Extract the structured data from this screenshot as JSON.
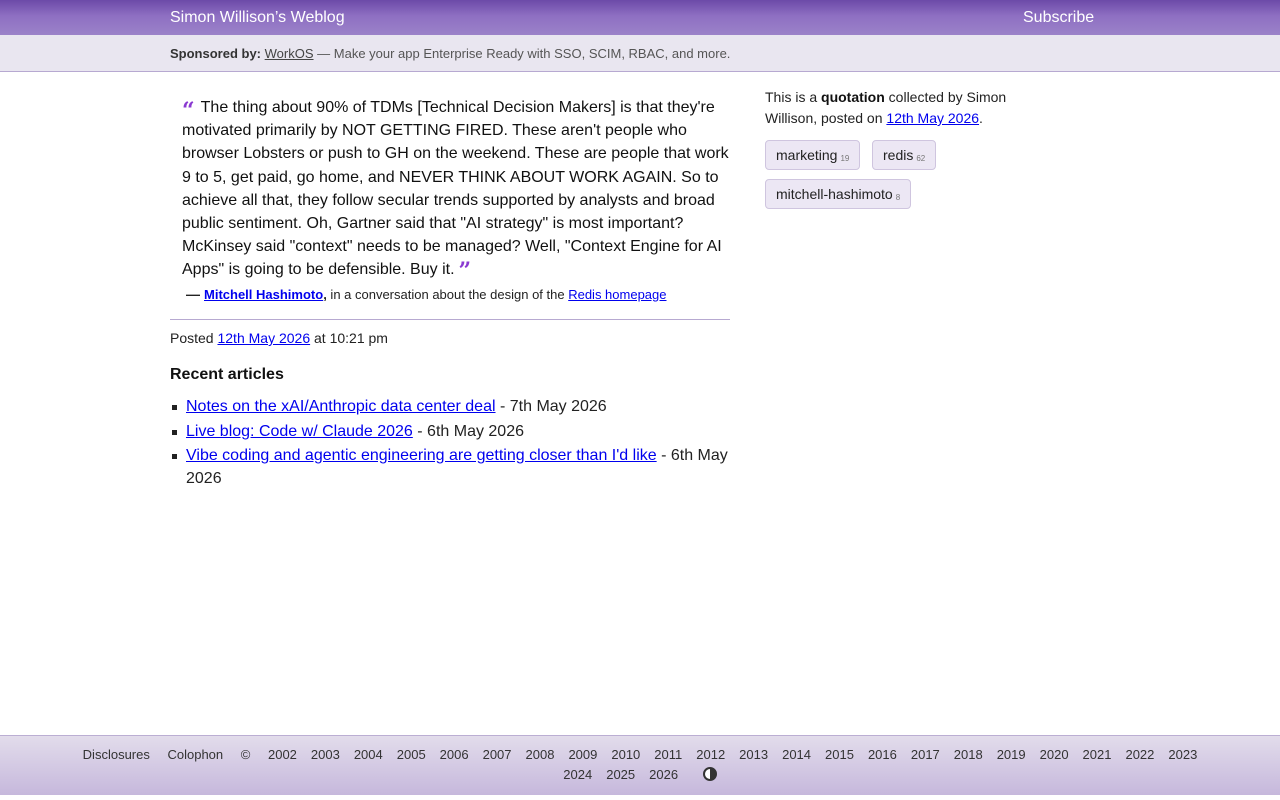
{
  "header": {
    "site_title": "Simon Willison’s Weblog",
    "subscribe": "Subscribe"
  },
  "sponsor": {
    "label": "Sponsored by:",
    "name": "WorkOS",
    "text": " — Make your app Enterprise Ready with SSO, SCIM, RBAC, and more."
  },
  "quote": {
    "open_mark": "“",
    "text": "The thing about 90% of TDMs [Technical Decision Makers] is that they're motivated primarily by NOT GETTING FIRED. These aren't people who browser Lobsters or push to GH on the weekend. These are people that work 9 to 5, get paid, go home, and NEVER THINK ABOUT WORK AGAIN. So to achieve all that, they follow secular trends supported by analysts and broad public sentiment. Oh, Gartner said that \"AI strategy\" is most important? McKinsey said \"context\" needs to be managed? Well, \"Context Engine for AI Apps\" is going to be defensible. Buy it.",
    "close_mark": "”",
    "cite_dash": "—",
    "author": "Mitchell Hashimoto",
    "author_comma": ",",
    "context": " in a conversation about the design of the ",
    "source_link": "Redis homepage"
  },
  "posted": {
    "prefix": "Posted ",
    "date": "12th May 2026",
    "time": " at 10:21 pm"
  },
  "recent": {
    "title": "Recent articles",
    "items": [
      {
        "title": "Notes on the xAI/Anthropic data center deal",
        "date": " - 7th May 2026"
      },
      {
        "title": "Live blog: Code w/ Claude 2026",
        "date": " - 6th May 2026"
      },
      {
        "title": "Vibe coding and agentic engineering are getting closer than I'd like",
        "date": " - 6th May 2026"
      }
    ]
  },
  "meta": {
    "prefix": "This is a ",
    "type": "quotation",
    "middle": " collected by Simon Willison, posted on ",
    "date": "12th May 2026",
    "suffix": "."
  },
  "tags": [
    {
      "name": "marketing",
      "count": "19"
    },
    {
      "name": "redis",
      "count": "62"
    },
    {
      "name": "mitchell-hashimoto",
      "count": "8"
    }
  ],
  "footer": {
    "disclosures": "Disclosures",
    "colophon": "Colophon",
    "copyright": "©",
    "years_line1": [
      "2002",
      "2003",
      "2004",
      "2005",
      "2006",
      "2007",
      "2008",
      "2009",
      "2010",
      "2011",
      "2012",
      "2013",
      "2014",
      "2015",
      "2016",
      "2017",
      "2018",
      "2019",
      "2020",
      "2021",
      "2022",
      "2023"
    ],
    "years_line2": [
      "2024",
      "2025",
      "2026"
    ],
    "contrast_icon": "contrast-icon"
  }
}
